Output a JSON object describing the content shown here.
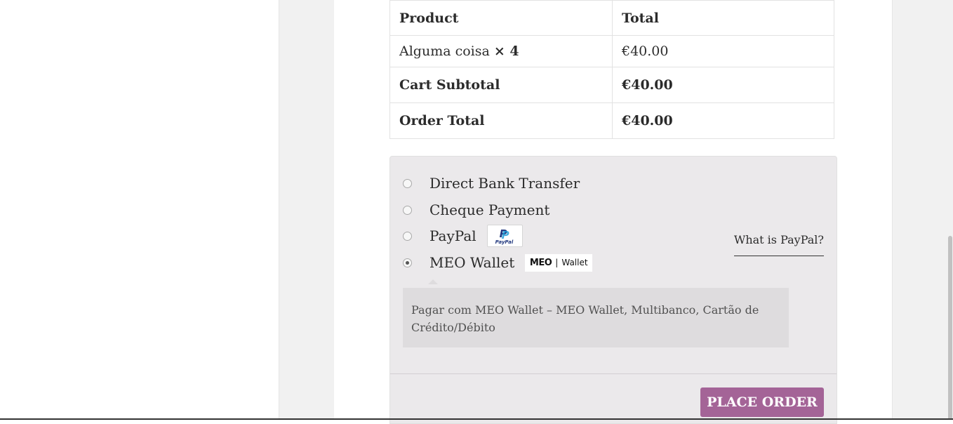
{
  "order_table": {
    "headers": [
      "Product",
      "Total"
    ],
    "line_item": {
      "name": "Alguma coisa",
      "qty": "× 4",
      "total": "€40.00"
    },
    "subtotal": {
      "label": "Cart Subtotal",
      "value": "€40.00"
    },
    "order_total": {
      "label": "Order Total",
      "value": "€40.00"
    }
  },
  "payment": {
    "methods": [
      {
        "label": "Direct Bank Transfer",
        "selected": false
      },
      {
        "label": "Cheque Payment",
        "selected": false
      },
      {
        "label": "PayPal",
        "selected": false
      },
      {
        "label": "MEO Wallet",
        "selected": true
      }
    ],
    "paypal_logo_text": "PayPal",
    "meo_logo": {
      "brand": "MEO",
      "sep": "|",
      "wallet": "Wallet"
    },
    "what_is_paypal": "What is PayPal?",
    "description": "Pagar com MEO Wallet – MEO Wallet, Multibanco, Cartão de Crédito/Débito",
    "place_order_label": "PLACE ORDER"
  },
  "colors": {
    "accent": "#a46497",
    "payment_bg": "#ebe9eb"
  }
}
